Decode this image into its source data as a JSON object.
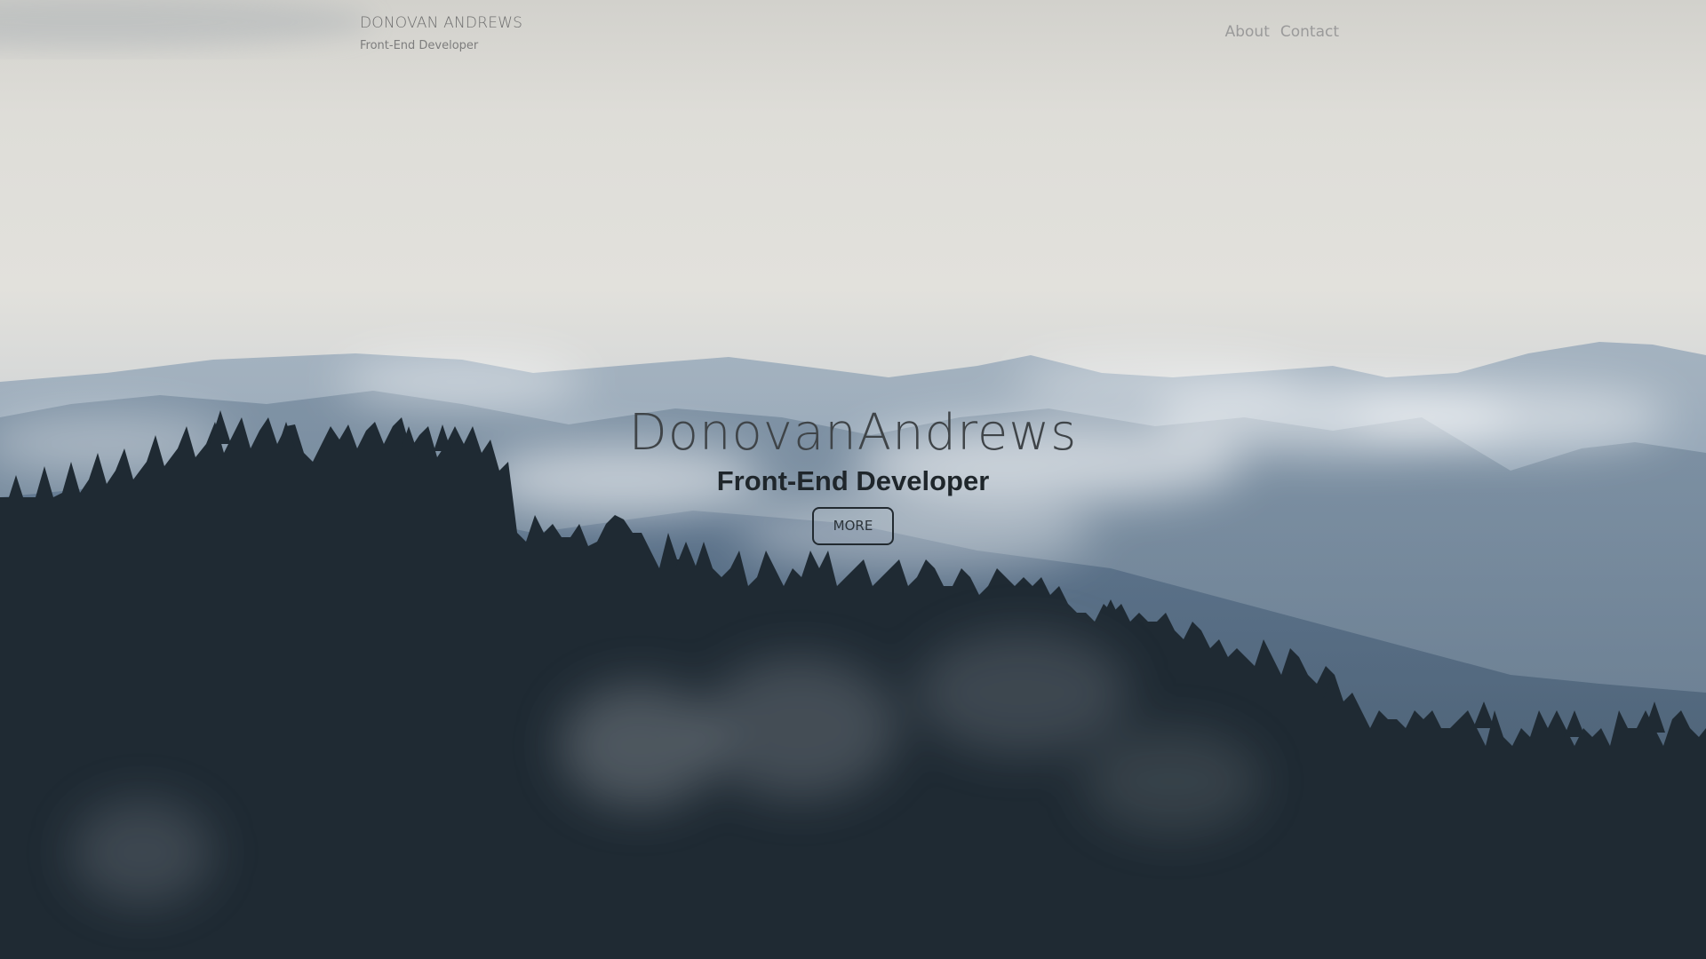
{
  "header": {
    "brand_name": "DONOVAN ANDREWS",
    "brand_subtitle": "Front-End Developer",
    "nav": [
      {
        "label": "About"
      },
      {
        "label": "Contact"
      }
    ]
  },
  "hero": {
    "title": "DonovanAndrews",
    "subtitle": "Front-End Developer",
    "button_label": "MORE"
  },
  "colors": {
    "sky": "#e2e1dc",
    "mountains": "#8c9cac",
    "forest": "#1f2a33",
    "nav_text": "#9a9a9a",
    "title_text": "#3f4448"
  }
}
